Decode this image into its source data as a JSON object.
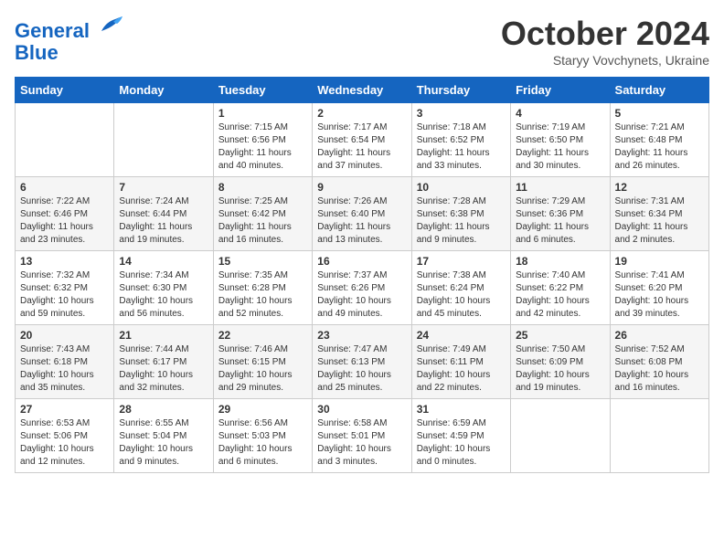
{
  "header": {
    "logo_line1": "General",
    "logo_line2": "Blue",
    "month": "October 2024",
    "location": "Staryy Vovchynets, Ukraine"
  },
  "days_of_week": [
    "Sunday",
    "Monday",
    "Tuesday",
    "Wednesday",
    "Thursday",
    "Friday",
    "Saturday"
  ],
  "weeks": [
    [
      {
        "day": "",
        "info": ""
      },
      {
        "day": "",
        "info": ""
      },
      {
        "day": "1",
        "info": "Sunrise: 7:15 AM\nSunset: 6:56 PM\nDaylight: 11 hours and 40 minutes."
      },
      {
        "day": "2",
        "info": "Sunrise: 7:17 AM\nSunset: 6:54 PM\nDaylight: 11 hours and 37 minutes."
      },
      {
        "day": "3",
        "info": "Sunrise: 7:18 AM\nSunset: 6:52 PM\nDaylight: 11 hours and 33 minutes."
      },
      {
        "day": "4",
        "info": "Sunrise: 7:19 AM\nSunset: 6:50 PM\nDaylight: 11 hours and 30 minutes."
      },
      {
        "day": "5",
        "info": "Sunrise: 7:21 AM\nSunset: 6:48 PM\nDaylight: 11 hours and 26 minutes."
      }
    ],
    [
      {
        "day": "6",
        "info": "Sunrise: 7:22 AM\nSunset: 6:46 PM\nDaylight: 11 hours and 23 minutes."
      },
      {
        "day": "7",
        "info": "Sunrise: 7:24 AM\nSunset: 6:44 PM\nDaylight: 11 hours and 19 minutes."
      },
      {
        "day": "8",
        "info": "Sunrise: 7:25 AM\nSunset: 6:42 PM\nDaylight: 11 hours and 16 minutes."
      },
      {
        "day": "9",
        "info": "Sunrise: 7:26 AM\nSunset: 6:40 PM\nDaylight: 11 hours and 13 minutes."
      },
      {
        "day": "10",
        "info": "Sunrise: 7:28 AM\nSunset: 6:38 PM\nDaylight: 11 hours and 9 minutes."
      },
      {
        "day": "11",
        "info": "Sunrise: 7:29 AM\nSunset: 6:36 PM\nDaylight: 11 hours and 6 minutes."
      },
      {
        "day": "12",
        "info": "Sunrise: 7:31 AM\nSunset: 6:34 PM\nDaylight: 11 hours and 2 minutes."
      }
    ],
    [
      {
        "day": "13",
        "info": "Sunrise: 7:32 AM\nSunset: 6:32 PM\nDaylight: 10 hours and 59 minutes."
      },
      {
        "day": "14",
        "info": "Sunrise: 7:34 AM\nSunset: 6:30 PM\nDaylight: 10 hours and 56 minutes."
      },
      {
        "day": "15",
        "info": "Sunrise: 7:35 AM\nSunset: 6:28 PM\nDaylight: 10 hours and 52 minutes."
      },
      {
        "day": "16",
        "info": "Sunrise: 7:37 AM\nSunset: 6:26 PM\nDaylight: 10 hours and 49 minutes."
      },
      {
        "day": "17",
        "info": "Sunrise: 7:38 AM\nSunset: 6:24 PM\nDaylight: 10 hours and 45 minutes."
      },
      {
        "day": "18",
        "info": "Sunrise: 7:40 AM\nSunset: 6:22 PM\nDaylight: 10 hours and 42 minutes."
      },
      {
        "day": "19",
        "info": "Sunrise: 7:41 AM\nSunset: 6:20 PM\nDaylight: 10 hours and 39 minutes."
      }
    ],
    [
      {
        "day": "20",
        "info": "Sunrise: 7:43 AM\nSunset: 6:18 PM\nDaylight: 10 hours and 35 minutes."
      },
      {
        "day": "21",
        "info": "Sunrise: 7:44 AM\nSunset: 6:17 PM\nDaylight: 10 hours and 32 minutes."
      },
      {
        "day": "22",
        "info": "Sunrise: 7:46 AM\nSunset: 6:15 PM\nDaylight: 10 hours and 29 minutes."
      },
      {
        "day": "23",
        "info": "Sunrise: 7:47 AM\nSunset: 6:13 PM\nDaylight: 10 hours and 25 minutes."
      },
      {
        "day": "24",
        "info": "Sunrise: 7:49 AM\nSunset: 6:11 PM\nDaylight: 10 hours and 22 minutes."
      },
      {
        "day": "25",
        "info": "Sunrise: 7:50 AM\nSunset: 6:09 PM\nDaylight: 10 hours and 19 minutes."
      },
      {
        "day": "26",
        "info": "Sunrise: 7:52 AM\nSunset: 6:08 PM\nDaylight: 10 hours and 16 minutes."
      }
    ],
    [
      {
        "day": "27",
        "info": "Sunrise: 6:53 AM\nSunset: 5:06 PM\nDaylight: 10 hours and 12 minutes."
      },
      {
        "day": "28",
        "info": "Sunrise: 6:55 AM\nSunset: 5:04 PM\nDaylight: 10 hours and 9 minutes."
      },
      {
        "day": "29",
        "info": "Sunrise: 6:56 AM\nSunset: 5:03 PM\nDaylight: 10 hours and 6 minutes."
      },
      {
        "day": "30",
        "info": "Sunrise: 6:58 AM\nSunset: 5:01 PM\nDaylight: 10 hours and 3 minutes."
      },
      {
        "day": "31",
        "info": "Sunrise: 6:59 AM\nSunset: 4:59 PM\nDaylight: 10 hours and 0 minutes."
      },
      {
        "day": "",
        "info": ""
      },
      {
        "day": "",
        "info": ""
      }
    ]
  ]
}
